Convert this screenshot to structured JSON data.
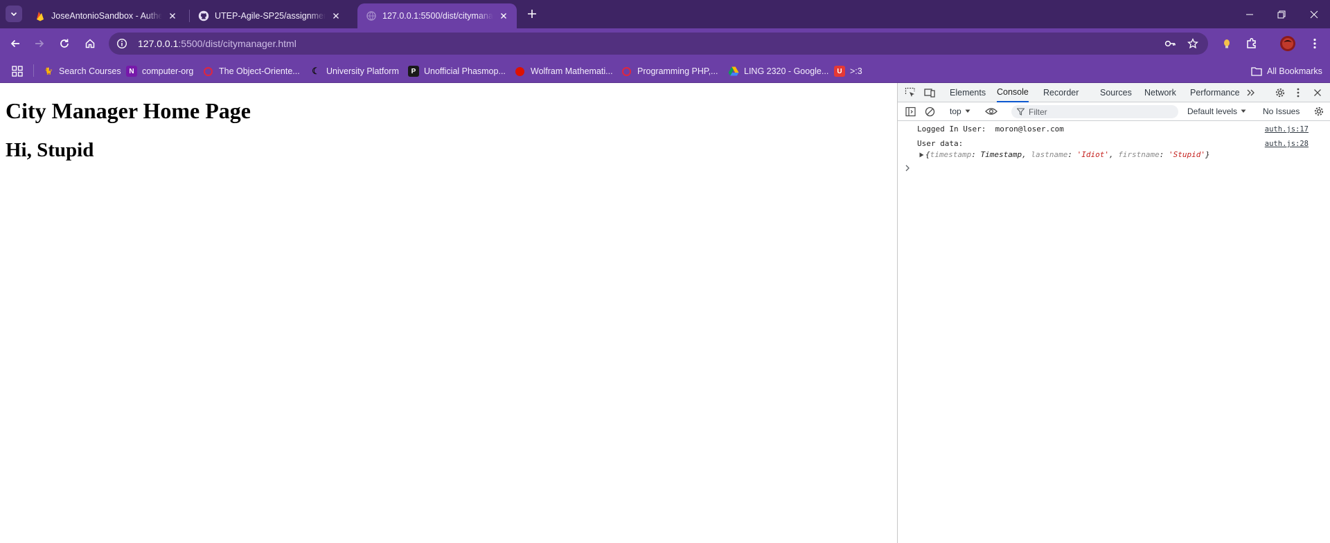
{
  "browser": {
    "tabs": [
      {
        "label": "JoseAntonioSandbox - Authenti",
        "active": false
      },
      {
        "label": "UTEP-Agile-SP25/assignment-2",
        "active": false
      },
      {
        "label": "127.0.0.1:5500/dist/citymanag",
        "active": true
      }
    ],
    "url_host": "127.0.0.1",
    "url_rest": ":5500/dist/citymanager.html",
    "bookmarks": [
      "Search Courses",
      "computer-org",
      "The Object-Oriente...",
      "University Platform",
      "Unofficial Phasmop...",
      "Wolfram Mathemati...",
      "Programming PHP,...",
      "LING 2320 - Google...",
      ">:3"
    ],
    "all_bookmarks": "All Bookmarks",
    "colors": {
      "frame": "#3e2464",
      "toolbar": "#6b3fa6",
      "active_tab": "#6b3fa6"
    }
  },
  "page": {
    "heading": "City Manager Home Page",
    "greeting": "Hi, Stupid"
  },
  "devtools": {
    "tabs": [
      "Elements",
      "Console",
      "Recorder",
      "Sources",
      "Network",
      "Performance"
    ],
    "active_tab": "Console",
    "context": "top",
    "filter_placeholder": "Filter",
    "levels": "Default levels",
    "issues": "No Issues",
    "console": {
      "line1_label": "Logged In User:",
      "line1_value": "moron@loser.com",
      "line1_source": "auth.js:17",
      "line2_label": "User data:",
      "line2_source": "auth.js:28",
      "object": {
        "timestamp_key": "timestamp",
        "timestamp_val": "Timestamp",
        "lastname_key": "lastname",
        "lastname_val": "'Idiot'",
        "firstname_key": "firstname",
        "firstname_val": "'Stupid'"
      }
    }
  }
}
